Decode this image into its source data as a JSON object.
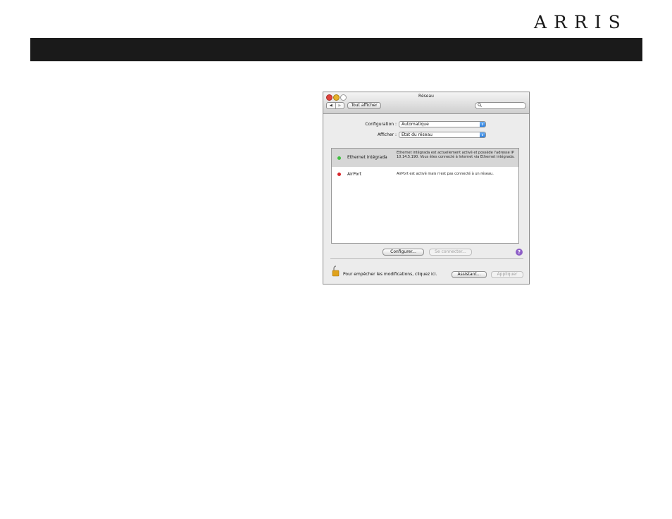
{
  "brand": {
    "logo_text": "ARRIS"
  },
  "window": {
    "title": "Réseau",
    "toolbar": {
      "show_all_label": "Tout afficher",
      "back_glyph": "◀",
      "forward_glyph": "▶",
      "search_placeholder": ""
    },
    "configuration": {
      "label": "Configuration :",
      "value": "Automatique"
    },
    "show": {
      "label": "Afficher :",
      "value": "État du réseau"
    },
    "services": [
      {
        "name": "Ethernet intégrada",
        "status": "green",
        "description": "Ethernet intégrada est actuellement activé et possède l'adresse IP 10.14.5.190. Vous êtes connecté à Internet via Ethernet intégrada.",
        "selected": true
      },
      {
        "name": "AirPort",
        "status": "red",
        "description": "AirPort est activé mais n'est pas connecté à un réseau.",
        "selected": false
      }
    ],
    "buttons": {
      "configure": "Configurer...",
      "connect": "Se connecter...",
      "assistant": "Assistant...",
      "apply": "Appliquer"
    },
    "lock_text": "Pour empêcher les modifications, cliquez ici.",
    "help_glyph": "?"
  },
  "colors": {
    "accent": "#2d7fde",
    "status_green": "#3fbf3f",
    "status_red": "#d8262b"
  },
  "icons": [
    "search-icon",
    "help-icon",
    "lock-icon",
    "arrows-icon"
  ]
}
